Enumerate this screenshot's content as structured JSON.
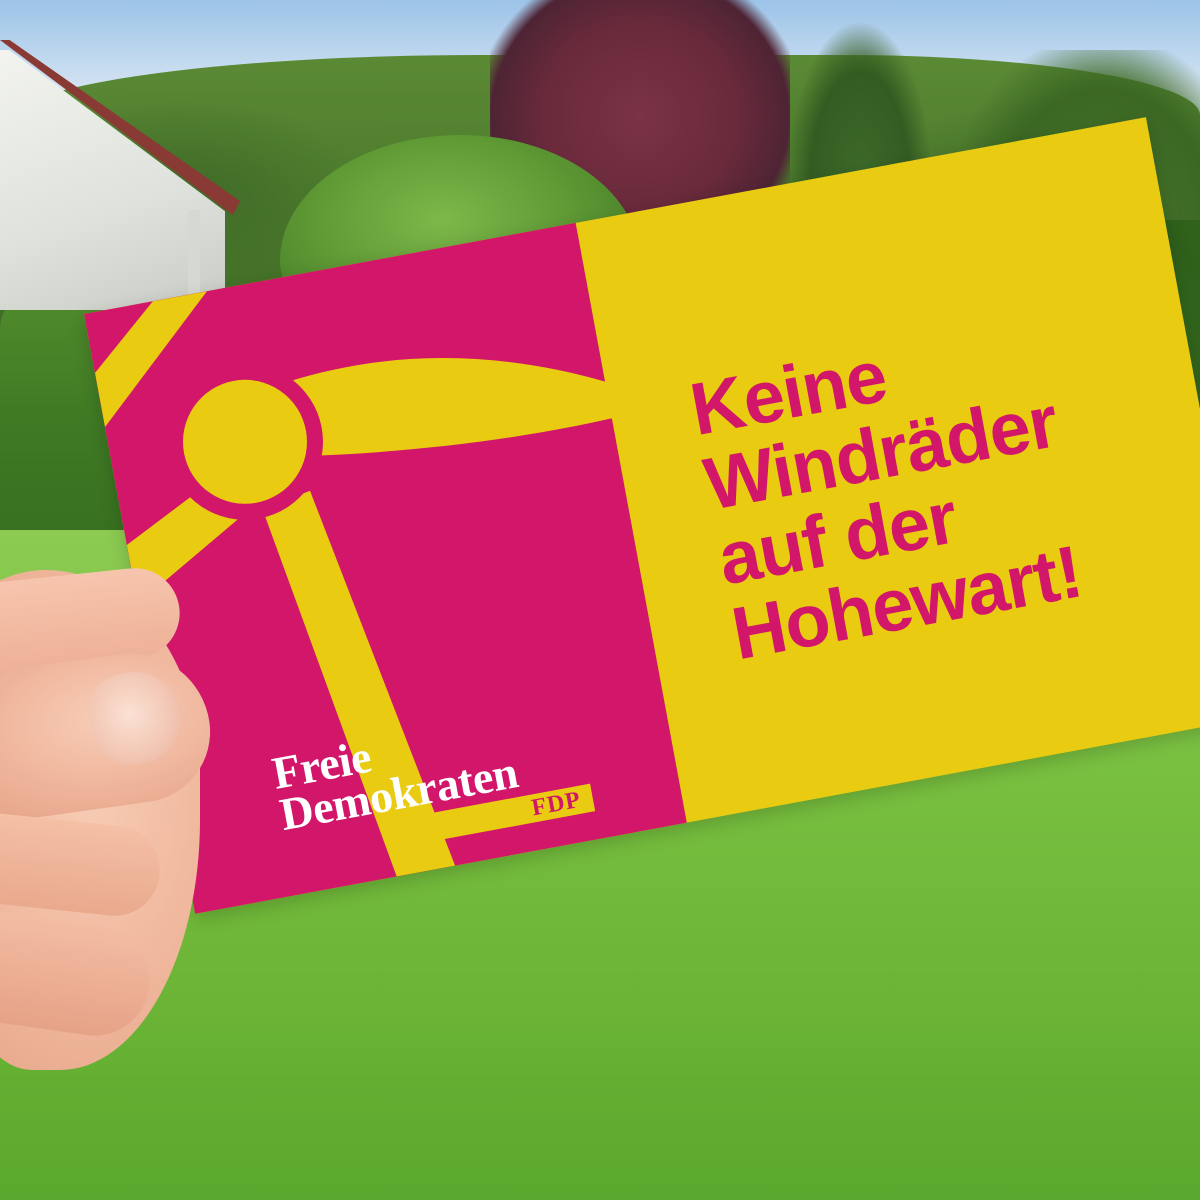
{
  "card": {
    "headline": {
      "line1": "Keine",
      "line2": "Windräder",
      "line3": "auf der",
      "line4": "Hohewart!"
    },
    "logo": {
      "line1": "Freie",
      "line2": "Demokraten",
      "party": "FDP"
    },
    "colors": {
      "magenta": "#d2166a",
      "yellow": "#e9cb12",
      "white": "#ffffff"
    },
    "artwork": "wind-turbine-icon"
  },
  "scene": {
    "elements": [
      "house",
      "bush",
      "hedge",
      "trees",
      "lawn",
      "hand"
    ]
  }
}
